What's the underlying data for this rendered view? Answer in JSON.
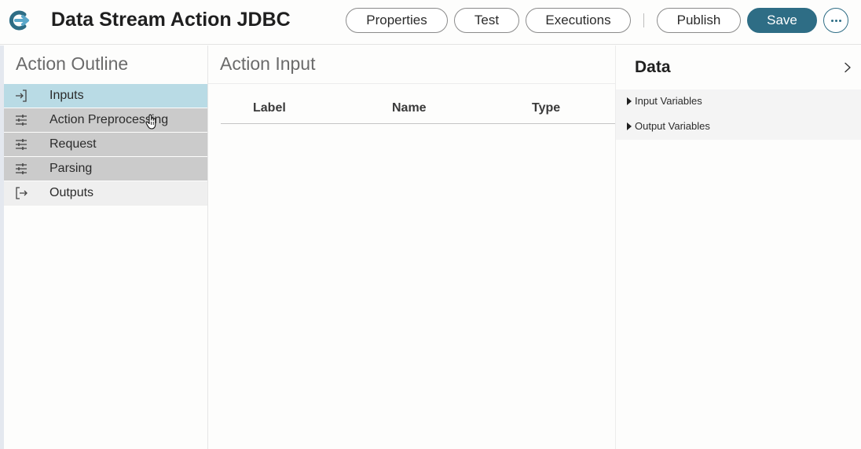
{
  "header": {
    "title": "Data Stream Action JDBC",
    "buttons": {
      "properties": "Properties",
      "test": "Test",
      "executions": "Executions",
      "publish": "Publish",
      "save": "Save"
    },
    "accent_color": "#2e6d85"
  },
  "outline": {
    "title": "Action Outline",
    "items": [
      {
        "label": "Inputs",
        "icon": "input-arrow-icon",
        "state": "active"
      },
      {
        "label": "Action Preprocessing",
        "icon": "sliders-icon",
        "state": "step"
      },
      {
        "label": "Request",
        "icon": "sliders-icon",
        "state": "step"
      },
      {
        "label": "Parsing",
        "icon": "sliders-icon",
        "state": "step"
      },
      {
        "label": "Outputs",
        "icon": "output-arrow-icon",
        "state": "normal"
      }
    ]
  },
  "center": {
    "title": "Action Input",
    "columns": [
      "Label",
      "Name",
      "Type"
    ]
  },
  "data_panel": {
    "title": "Data",
    "sections": [
      "Input Variables",
      "Output Variables"
    ]
  }
}
